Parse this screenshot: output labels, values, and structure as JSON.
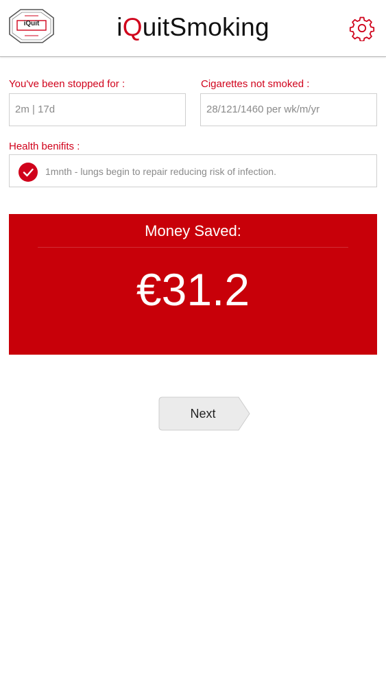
{
  "header": {
    "title_prefix": "i",
    "title_accent": "Q",
    "title_suffix": "uitSmoking",
    "logo_text": "iQuit",
    "settings_icon": "gear-icon",
    "accent_color": "#d0021b"
  },
  "stopped": {
    "label": "You've been stopped for :",
    "value": "2m | 17d"
  },
  "cigarettes": {
    "label": "Cigarettes not smoked :",
    "value": "28/121/1460 per wk/m/yr"
  },
  "health": {
    "label": "Health benifits :",
    "check_icon": "check-circle-icon",
    "item": "1mnth - lungs begin to repair reducing risk of infection."
  },
  "money": {
    "label": "Money Saved:",
    "value": "€31.2",
    "background_color": "#c80009"
  },
  "next_button": {
    "label": "Next"
  }
}
